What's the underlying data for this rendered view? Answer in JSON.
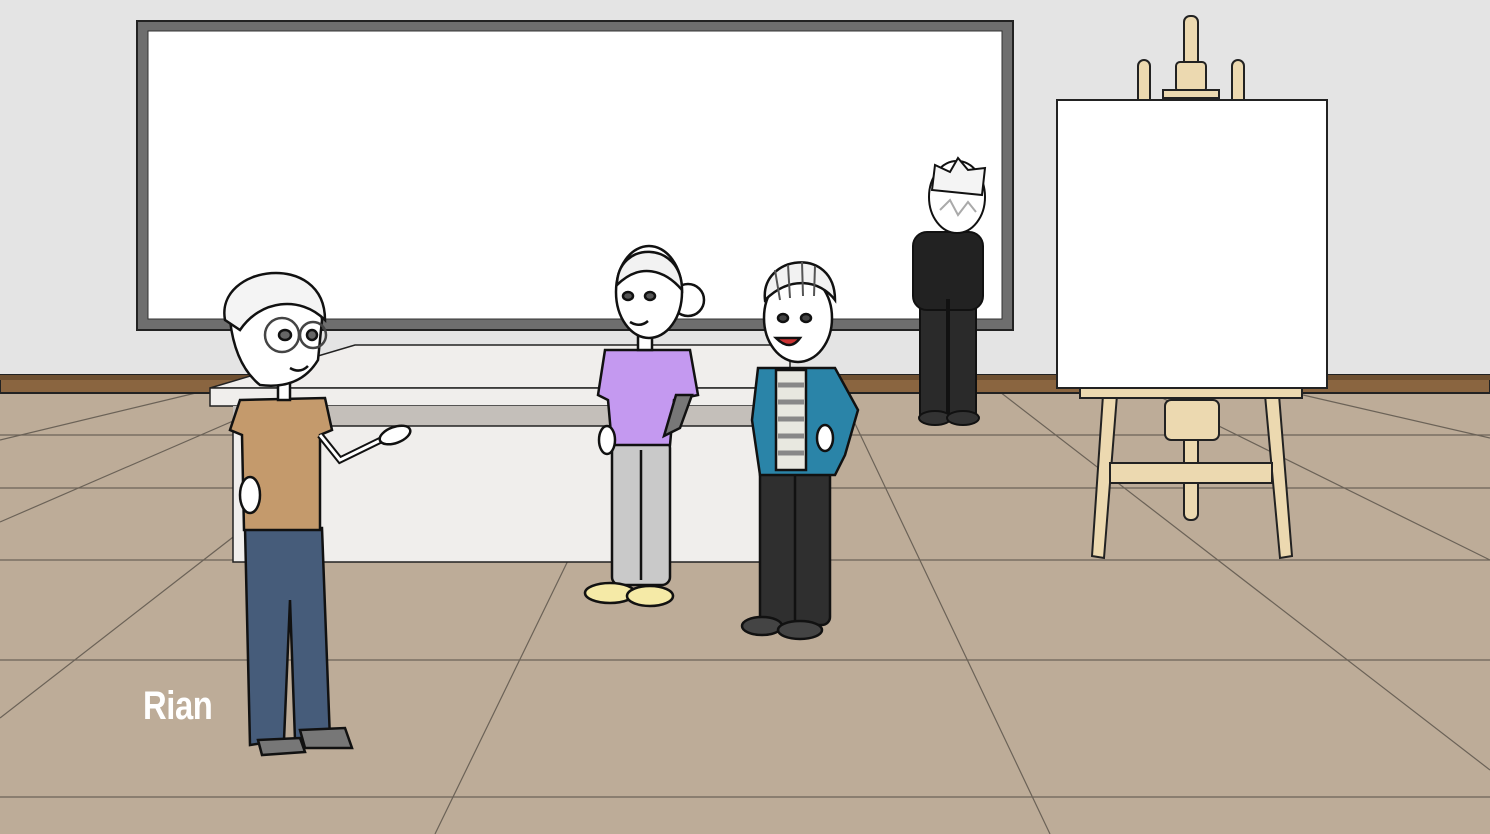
{
  "scene": {
    "setting": "classroom",
    "caption_name": "Rian"
  },
  "colors": {
    "wall": "#e4e4e4",
    "floor": "#bdac98",
    "baseboard": "#8a6540",
    "whiteboard_frame": "#6e6e6e",
    "easel_wood": "#ecd9b0",
    "shirt_rian": "#c49a6c",
    "jeans_rian": "#465c7a",
    "shirt_girl": "#c499f0",
    "jacket_boy": "#2a84a8"
  }
}
